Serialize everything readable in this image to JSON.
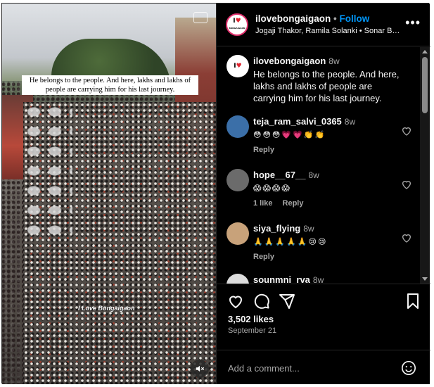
{
  "video": {
    "caption": "He belongs to the people. And here, lakhs and lakhs of people are carrying him for his last journey.",
    "watermark": "I Love Bongaigaon",
    "mute_icon": "speaker-muted-icon"
  },
  "header": {
    "avatar_logo": {
      "top": "I",
      "bottom": "BONGAIGAON"
    },
    "username": "ilovebongaigaon",
    "separator": "•",
    "follow_label": "Follow",
    "subtitle": "Jogaji Thakor, Ramila Solanki • Sonar Bar…",
    "more_icon": "more-options-icon"
  },
  "post": {
    "username": "ilovebongaigaon",
    "time": "8w",
    "text": "He belongs to the people. And here, lakhs and lakhs of people are carrying him for his last journey."
  },
  "comments": [
    {
      "username": "teja_ram_salvi_0365",
      "time": "8w",
      "text": "😳😳😳💗💗👏👏",
      "reply": "Reply",
      "likes": ""
    },
    {
      "username": "hope__67__",
      "time": "8w",
      "text": "😱😱😱😱",
      "likes": "1 like",
      "reply": "Reply"
    },
    {
      "username": "siya_flying",
      "time": "8w",
      "text": "🙏🙏🙏🙏🙏😢😢",
      "reply": "Reply",
      "likes": ""
    },
    {
      "username": "sounmni_rva",
      "time": "8w",
      "text": "",
      "reply": "",
      "likes": ""
    }
  ],
  "actions": {
    "likes": "3,502 likes",
    "date": "September 21"
  },
  "composer": {
    "placeholder": "Add a comment..."
  },
  "colors": {
    "background": "#000000",
    "text": "#f5f5f5",
    "secondary": "#a8a8a8",
    "follow": "#0095f6",
    "divider": "#262626"
  }
}
